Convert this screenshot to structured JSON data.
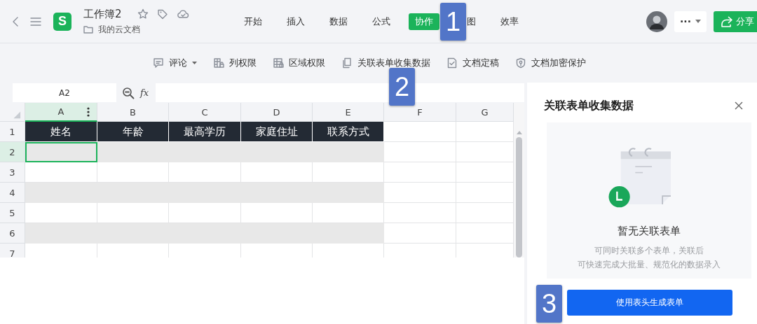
{
  "header": {
    "logo": "S",
    "title": "工作簿2",
    "location": "我的云文档",
    "menu_tabs": [
      {
        "label": "开始",
        "selected": false
      },
      {
        "label": "插入",
        "selected": false
      },
      {
        "label": "数据",
        "selected": false
      },
      {
        "label": "公式",
        "selected": false
      },
      {
        "label": "协作",
        "selected": true
      },
      {
        "label": "图",
        "selected": false
      },
      {
        "label": "效率",
        "selected": false
      }
    ],
    "more_button": "···",
    "share_button": "分享"
  },
  "toolbar": [
    {
      "kind": "comment",
      "label": "评论",
      "dropdown": true
    },
    {
      "kind": "column",
      "label": "列权限",
      "dropdown": false
    },
    {
      "kind": "region",
      "label": "区域权限",
      "dropdown": false
    },
    {
      "kind": "copy",
      "label": "关联表单收集数据",
      "dropdown": false
    },
    {
      "kind": "check",
      "label": "文档定稿",
      "dropdown": false
    },
    {
      "kind": "shield",
      "label": "文档加密保护",
      "dropdown": false
    }
  ],
  "formula_bar": {
    "cell_ref": "A2",
    "fx": "fx"
  },
  "sheet": {
    "columns": [
      {
        "label": "A",
        "selected": true
      },
      {
        "label": "B",
        "selected": false
      },
      {
        "label": "C",
        "selected": false
      },
      {
        "label": "D",
        "selected": false
      },
      {
        "label": "E",
        "selected": false
      },
      {
        "label": "F",
        "selected": false
      },
      {
        "label": "G",
        "selected": false
      }
    ],
    "rows": [
      {
        "label": "1",
        "kind": "header",
        "selected": false,
        "cells": [
          "姓名",
          "年龄",
          "最高学历",
          "家庭住址",
          "联系方式"
        ]
      },
      {
        "label": "2",
        "kind": "band",
        "selected": true
      },
      {
        "label": "3",
        "kind": "plain",
        "selected": false
      },
      {
        "label": "4",
        "kind": "band",
        "selected": false
      },
      {
        "label": "5",
        "kind": "plain",
        "selected": false
      },
      {
        "label": "6",
        "kind": "band",
        "selected": false
      },
      {
        "label": "7",
        "kind": "plain",
        "selected": false
      }
    ]
  },
  "panel": {
    "title": "关联表单收集数据",
    "empty_title": "暂无关联表单",
    "empty_lines": [
      "可同时关联多个表单，关联后",
      "可快速完成大批量、规范化的数据录入"
    ],
    "button": "使用表头生成表单"
  },
  "callouts": [
    "1",
    "2",
    "3"
  ]
}
